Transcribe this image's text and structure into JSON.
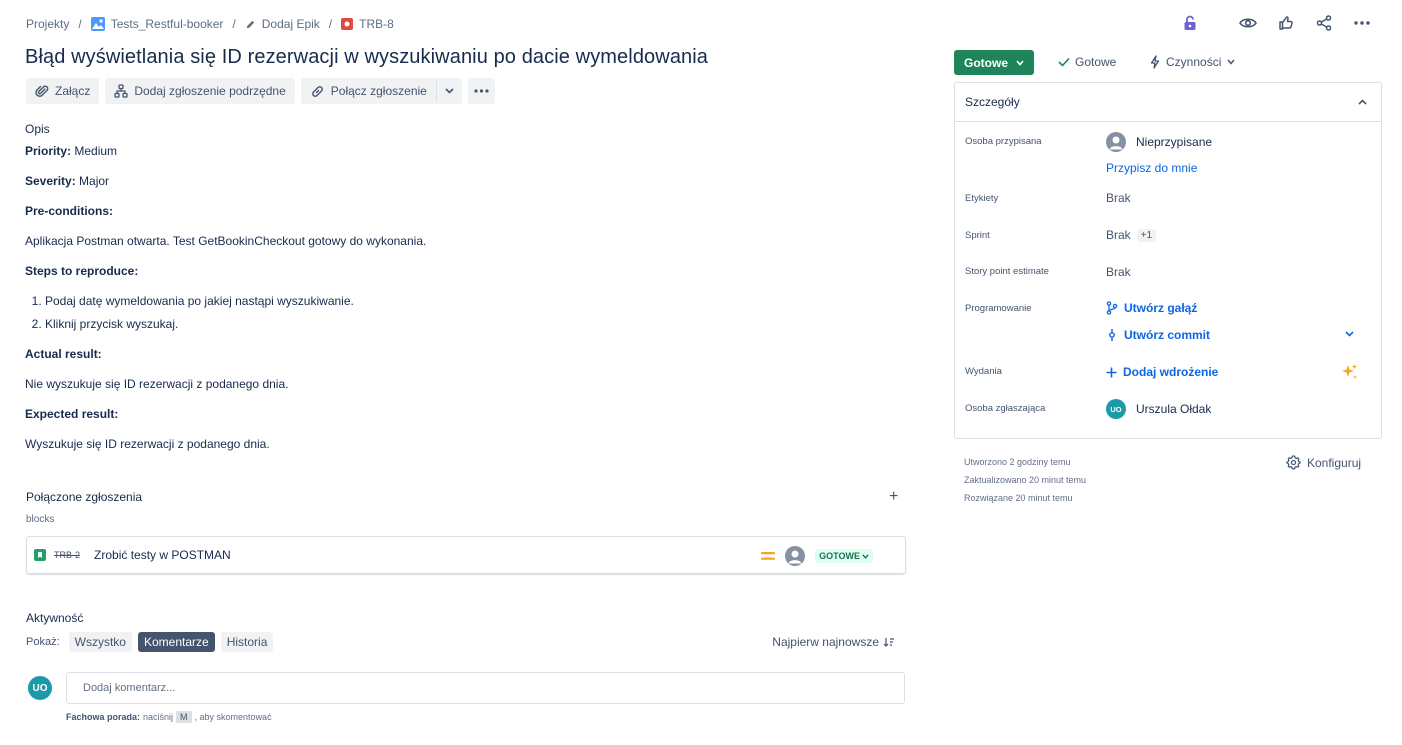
{
  "breadcrumb": {
    "projects": "Projekty",
    "project": "Tests_Restful-booker",
    "epic": "Dodaj Epik",
    "issue_key": "TRB-8",
    "separator": "/"
  },
  "issue": {
    "title": "Błąd wyświetlania się ID rezerwacji w wyszukiwaniu po dacie wymeldowania"
  },
  "toolbar": {
    "attach": "Załącz",
    "add_child": "Dodaj zgłoszenie podrzędne",
    "link_issue": "Połącz zgłoszenie"
  },
  "description": {
    "label": "Opis",
    "priority_label": "Priority:",
    "priority_value": "Medium",
    "severity_label": "Severity:",
    "severity_value": "Major",
    "preconditions_label": "Pre-conditions:",
    "preconditions_text": "Aplikacja Postman otwarta. Test GetBookinCheckout gotowy do wykonania.",
    "steps_label": "Steps to reproduce:",
    "steps": [
      "Podaj datę wymeldowania po jakiej nastąpi wyszukiwanie.",
      "Kliknij przycisk wyszukaj."
    ],
    "actual_label": "Actual result:",
    "actual_text": "Nie wyszukuje się ID rezerwacji z podanego dnia.",
    "expected_label": "Expected result:",
    "expected_text": "Wyszukuje się ID rezerwacji z podanego dnia."
  },
  "linked": {
    "title": "Połączone zgłoszenia",
    "relation": "blocks",
    "add": "+",
    "item": {
      "key": "TRB-2",
      "summary": "Zrobić testy w POSTMAN",
      "status": "GOTOWE"
    }
  },
  "activity": {
    "title": "Aktywność",
    "show_label": "Pokaż:",
    "filters": [
      "Wszystko",
      "Komentarze",
      "Historia"
    ],
    "active_filter": "Komentarze",
    "sort": "Najpierw najnowsze",
    "avatar_initials": "UO",
    "comment_placeholder": "Dodaj komentarz...",
    "tip_bold": "Fachowa porada:",
    "tip_pre": "naciśnij",
    "tip_key": "M",
    "tip_post": ", aby skomentować"
  },
  "panel": {
    "status": "Gotowe",
    "resolution": "Gotowe",
    "actions": "Czynności",
    "details_title": "Szczegóły",
    "assignee_label": "Osoba przypisana",
    "assignee_value": "Nieprzypisane",
    "assign_to_me": "Przypisz do mnie",
    "labels_label": "Etykiety",
    "labels_value": "Brak",
    "sprint_label": "Sprint",
    "sprint_value": "Brak",
    "sprint_badge": "+1",
    "story_points_label": "Story point estimate",
    "story_points_value": "Brak",
    "development_label": "Programowanie",
    "create_branch": "Utwórz gałąź",
    "create_commit": "Utwórz commit",
    "releases_label": "Wydania",
    "add_deployment": "Dodaj wdrożenie",
    "reporter_label": "Osoba zgłaszająca",
    "reporter_initials": "UO",
    "reporter_value": "Urszula Ołdak",
    "created": "Utworzono 2 godziny temu",
    "updated": "Zaktualizowano 20 minut temu",
    "resolved": "Rozwiązane 20 minut temu",
    "configure": "Konfiguruj"
  },
  "colors": {
    "status_green": "#1f845a",
    "link_blue": "#0c66e4",
    "bug_red": "#e2483d",
    "story_green": "#22a06b",
    "priority_orange": "#f5a623",
    "avatar_teal": "#1d9aaa",
    "active_filter": "#44546f"
  }
}
